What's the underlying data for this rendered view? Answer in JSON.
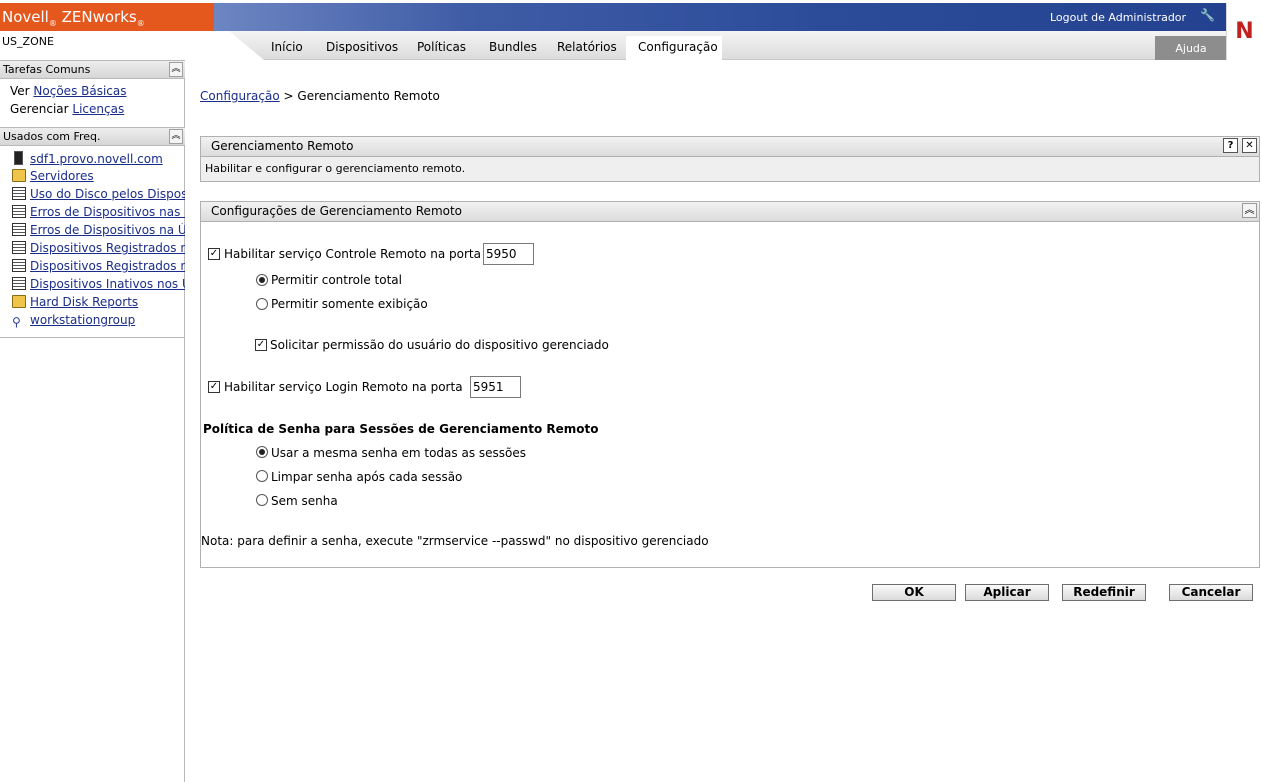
{
  "header": {
    "brand_novell": "Novell",
    "brand_zenworks": "ZENworks",
    "registered": "®",
    "logout_label": "Logout de Administrador",
    "zone": "US_ZONE",
    "help_label": "Ajuda",
    "n_logo": "N",
    "tabs": [
      "Início",
      "Dispositivos",
      "Políticas",
      "Bundles",
      "Relatórios",
      "Configuração"
    ],
    "active_tab": "Configuração"
  },
  "sidebar": {
    "tasks_title": "Tarefas Comuns",
    "tasks": [
      {
        "prefix": "Ver",
        "link": "Noções Básicas"
      },
      {
        "prefix": "Gerenciar",
        "link": "Licenças"
      }
    ],
    "freq_title": "Usados com Freq.",
    "freq_items": [
      {
        "label": "sdf1.provo.novell.com",
        "icon": "server-icon"
      },
      {
        "label": "Servidores",
        "icon": "folder-icon"
      },
      {
        "label": "Uso do Disco pelos Dispositivos",
        "icon": "report-icon"
      },
      {
        "label": "Erros de Dispositivos nas Últimas",
        "icon": "report-icon"
      },
      {
        "label": "Erros de Dispositivos na Última",
        "icon": "report-icon"
      },
      {
        "label": "Dispositivos Registrados nos",
        "icon": "report-icon"
      },
      {
        "label": "Dispositivos Registrados nos",
        "icon": "report-icon"
      },
      {
        "label": "Dispositivos Inativos nos Últimos",
        "icon": "report-icon"
      },
      {
        "label": "Hard Disk Reports",
        "icon": "folder-icon"
      },
      {
        "label": "workstationgroup",
        "icon": "group-icon"
      }
    ]
  },
  "breadcrumb": {
    "parent": "Configuração",
    "separator": ">",
    "current": "Gerenciamento Remoto"
  },
  "panel_intro": {
    "title": "Gerenciamento Remoto",
    "description": "Habilitar e configurar o gerenciamento remoto.",
    "help_glyph": "?",
    "close_glyph": "✕"
  },
  "settings": {
    "title": "Configurações de Gerenciamento Remoto",
    "remote_control_label": "Habilitar serviço Controle Remoto na porta",
    "remote_control_enabled": true,
    "remote_control_port": "5950",
    "full_control_label": "Permitir controle total",
    "view_only_label": "Permitir somente exibição",
    "selected_mode": "full_control",
    "ask_permission_label": "Solicitar permissão do usuário do dispositivo gerenciado",
    "ask_permission_enabled": true,
    "remote_login_label": "Habilitar serviço Login Remoto na porta",
    "remote_login_enabled": true,
    "remote_login_port": "5951",
    "password_policy_title": "Política de Senha para Sessões de Gerenciamento Remoto",
    "pw_same_label": "Usar a mesma senha em todas as sessões",
    "pw_clear_label": "Limpar senha após cada sessão",
    "pw_none_label": "Sem senha",
    "selected_password_policy": "same",
    "note": "Nota: para definir a senha, execute \"zrmservice --passwd\" no dispositivo gerenciado"
  },
  "actions": {
    "ok": "OK",
    "apply": "Aplicar",
    "reset": "Redefinir",
    "cancel": "Cancelar"
  },
  "colors": {
    "brand_orange": "#e4581e",
    "banner_blue": "#2c4c9a",
    "link_blue": "#1a2d8a",
    "novell_red": "#c0201e"
  }
}
